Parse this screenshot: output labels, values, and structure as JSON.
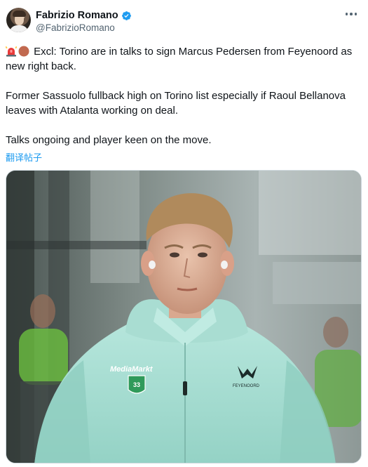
{
  "author": {
    "display_name": "Fabrizio Romano",
    "handle": "@FabrizioRomano",
    "verified": true,
    "verified_color": "#1d9bf0"
  },
  "tweet": {
    "emojis": [
      "police-car-light-emoji",
      "brown-circle-emoji"
    ],
    "line1": "Excl: Torino are in talks to sign Marcus Pedersen from Feyenoord as new right back.",
    "line2": "Former Sassuolo fullback high on Torino list especially if Raoul Bellanova leaves with Atalanta working on deal.",
    "line3": "Talks ongoing and player keen on the move.",
    "translate_label": "翻译帖子"
  },
  "media": {
    "jacket_sponsor": "MediaMarkt",
    "club_badge": "FEYENOORD",
    "shirt_number": "33",
    "jacket_color": "#a7ddd2"
  },
  "icons": {
    "more": "more-horizontal-icon",
    "verified": "verified-badge-icon"
  }
}
